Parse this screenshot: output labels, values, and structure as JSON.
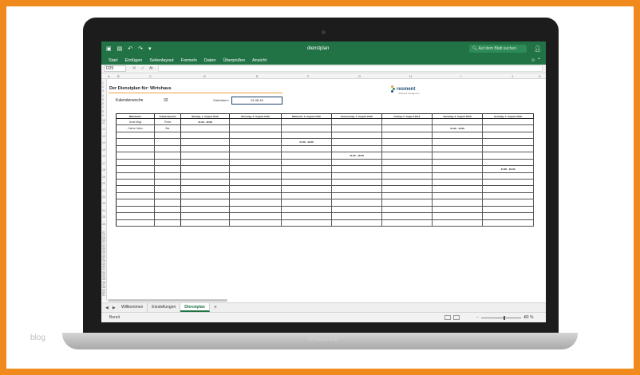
{
  "app": {
    "title": "dienstplan",
    "search_placeholder": "Auf dem Blatt suchen",
    "menu": [
      "Start",
      "Einfügen",
      "Seitenlayout",
      "Formeln",
      "Daten",
      "Überprüfen",
      "Ansicht"
    ],
    "name_box": "D29",
    "fx": "fx"
  },
  "columns": [
    "A",
    "B",
    "C",
    "D",
    "E",
    "F",
    "G",
    "H",
    "I",
    "J",
    "K"
  ],
  "rows": [
    "1",
    "2",
    "3",
    "4",
    "5",
    "6",
    "7",
    "8",
    "9",
    "10",
    "11",
    "12",
    "13",
    "14",
    "15",
    "16",
    "17",
    "18",
    "19",
    "20",
    "21",
    "22",
    "23",
    "24",
    "25",
    "26",
    "27",
    "28",
    "29",
    "30",
    "31",
    "32",
    "33",
    "34",
    "35",
    "36",
    "37",
    "38",
    "39",
    "40",
    "41",
    "42",
    "43",
    "44",
    "45",
    "46",
    "47",
    "48",
    "49",
    "50",
    "51"
  ],
  "sheet": {
    "title": "Der Dienstplan für: Wirtshaus",
    "kalenderwoche_label": "Kalenderwoche",
    "kalenderwoche_value": "32",
    "startdatum_label": "Startdatum",
    "startdatum_value": "01.08.16",
    "logo_text": "resment",
    "logo_sub": "restaurant management"
  },
  "schedule": {
    "headers": [
      "Mitarbeiter",
      "Arbeitsbereich",
      "Montag, 1. August 2016",
      "Dienstag, 2. August 2016",
      "Mittwoch, 3. August 2016",
      "Donnerstag, 4. August 2016",
      "Freitag, 5. August 2016",
      "Samstag, 6. August 2016",
      "Sonntag, 7. August 2016"
    ],
    "rows": [
      [
        "Anna Mogi",
        "Theke",
        "11:30 - 19:00",
        "",
        "",
        "",
        "",
        "",
        ""
      ],
      [
        "Carlos Catzo",
        "Bar",
        "",
        "",
        "",
        "",
        "",
        "11:30 - 19:00",
        ""
      ],
      [
        "",
        "",
        "",
        "",
        "",
        "",
        "",
        "",
        ""
      ],
      [
        "",
        "",
        "",
        "",
        "11:30 - 19:00",
        "",
        "",
        "",
        ""
      ],
      [
        "",
        "",
        "",
        "",
        "",
        "",
        "",
        "",
        ""
      ],
      [
        "",
        "",
        "",
        "",
        "",
        "11:30 - 19:00",
        "",
        "",
        ""
      ],
      [
        "",
        "",
        "",
        "",
        "",
        "",
        "",
        "",
        ""
      ],
      [
        "",
        "",
        "",
        "",
        "",
        "",
        "",
        "",
        "11:30 - 19:00"
      ],
      [
        "",
        "",
        "",
        "",
        "",
        "",
        "",
        "",
        ""
      ],
      [
        "",
        "",
        "",
        "",
        "",
        "",
        "",
        "",
        ""
      ],
      [
        "",
        "",
        "",
        "",
        "",
        "",
        "",
        "",
        ""
      ],
      [
        "",
        "",
        "",
        "",
        "",
        "",
        "",
        "",
        ""
      ],
      [
        "",
        "",
        "",
        "",
        "",
        "",
        "",
        "",
        ""
      ],
      [
        "",
        "",
        "",
        "",
        "",
        "",
        "",
        "",
        ""
      ],
      [
        "",
        "",
        "",
        "",
        "",
        "",
        "",
        "",
        ""
      ],
      [
        "",
        "",
        "",
        "",
        "",
        "",
        "",
        "",
        ""
      ]
    ]
  },
  "tabs": [
    "Willkommen",
    "Einstellungen",
    "Dienstplan"
  ],
  "active_tab": "Dienstplan",
  "status": {
    "mode": "Bereit",
    "zoom": "80 %"
  },
  "device": {
    "label": "MacBook",
    "watermark": "blog"
  },
  "colors": {
    "frame": "#f08a1c",
    "excel_green": "#217346",
    "title_rule": "#e8a33a"
  }
}
